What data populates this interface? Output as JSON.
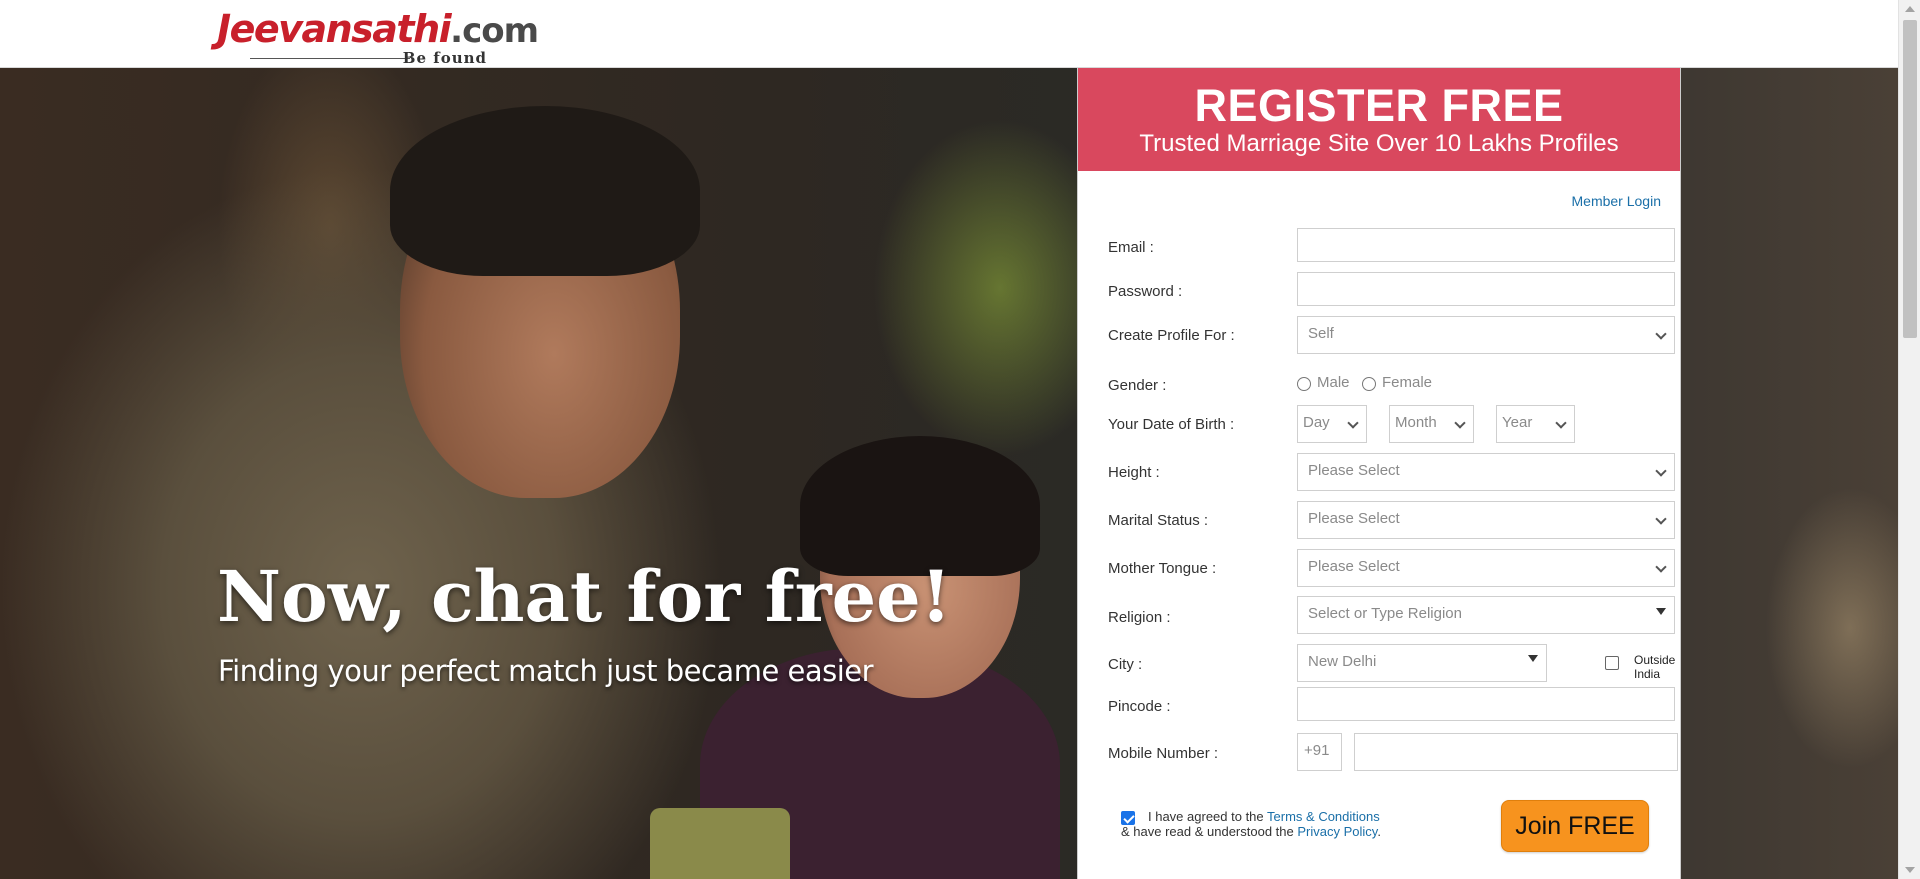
{
  "logo": {
    "brand": "Jeevansathi",
    "domain": ".com",
    "tagline": "Be found"
  },
  "hero": {
    "title": "Now, chat for free!",
    "subtitle": "Finding your perfect match just became easier"
  },
  "panel": {
    "title": "REGISTER FREE",
    "subtitle": "Trusted Marriage Site Over 10 Lakhs Profiles",
    "member_login": "Member Login"
  },
  "form": {
    "email_label": "Email :",
    "email_value": "",
    "password_label": "Password :",
    "password_value": "",
    "profile_for_label": "Create Profile For :",
    "profile_for_value": "Self",
    "gender_label": "Gender :",
    "gender_male": "Male",
    "gender_female": "Female",
    "dob_label": "Your Date of Birth :",
    "dob_day": "Day",
    "dob_month": "Month",
    "dob_year": "Year",
    "height_label": "Height :",
    "height_value": "Please Select",
    "marital_label": "Marital Status :",
    "marital_value": "Please Select",
    "tongue_label": "Mother Tongue :",
    "tongue_value": "Please Select",
    "religion_label": "Religion :",
    "religion_value": "Select or Type Religion",
    "city_label": "City :",
    "city_value": "New Delhi",
    "outside_india": "Outside India",
    "pincode_label": "Pincode :",
    "pincode_value": "",
    "mobile_label": "Mobile Number :",
    "mobile_code": "+91",
    "mobile_value": ""
  },
  "agreement": {
    "text1": "I have agreed to the ",
    "terms_link": "Terms & Conditions",
    "text2": "& have read & understood the ",
    "privacy_link": "Privacy Policy",
    "text3": ".",
    "checked": true
  },
  "join_button": "Join FREE"
}
